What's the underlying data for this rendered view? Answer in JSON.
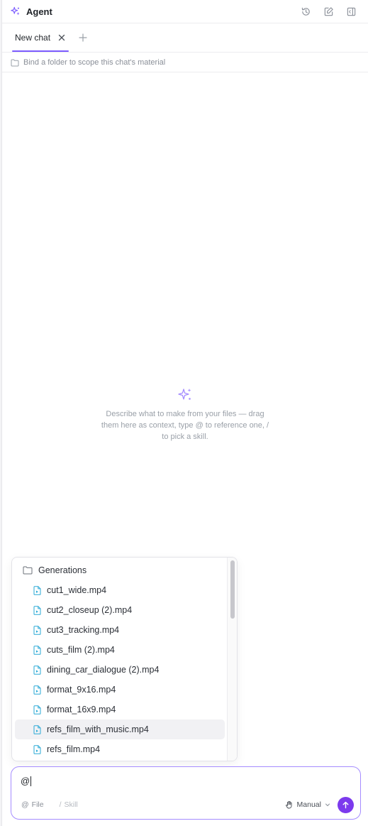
{
  "header": {
    "title": "Agent",
    "icons": [
      "sparkle-icon",
      "history-icon",
      "new-note-icon",
      "panel-toggle-icon"
    ]
  },
  "tabs": [
    {
      "label": "New chat",
      "active": true
    }
  ],
  "bind_folder": {
    "text": "Bind a folder to scope this chat's material"
  },
  "empty_state": {
    "text": "Describe what to make from your files — drag them here as context, type @ to reference one, / to pick a skill."
  },
  "file_picker": {
    "folder": "Generations",
    "files": [
      "cut1_wide.mp4",
      "cut2_closeup (2).mp4",
      "cut3_tracking.mp4",
      "cuts_film (2).mp4",
      "dining_car_dialogue (2).mp4",
      "format_9x16.mp4",
      "format_16x9.mp4",
      "refs_film_with_music.mp4",
      "refs_film.mp4"
    ],
    "highlighted_index": 7
  },
  "composer": {
    "value": "@",
    "file_chip": "File",
    "file_chip_symbol": "@",
    "skill_chip": "Skill",
    "skill_chip_symbol": "/",
    "mode_label": "Manual"
  },
  "colors": {
    "accent": "#7c5cff",
    "send_button": "#7c3aed",
    "file_icon": "#2aa9d6"
  }
}
